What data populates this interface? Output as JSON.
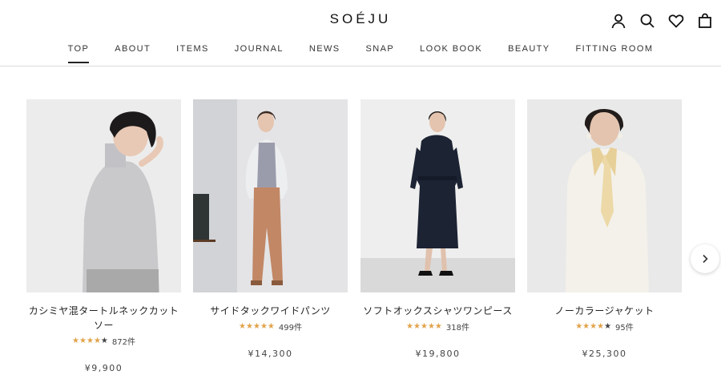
{
  "brand": "SOÉJU",
  "header_icons": [
    "account-icon",
    "search-icon",
    "heart-icon",
    "bag-icon"
  ],
  "nav": [
    {
      "label": "TOP",
      "active": true
    },
    {
      "label": "ABOUT"
    },
    {
      "label": "ITEMS"
    },
    {
      "label": "JOURNAL"
    },
    {
      "label": "NEWS"
    },
    {
      "label": "SNAP"
    },
    {
      "label": "LOOK BOOK"
    },
    {
      "label": "BEAUTY"
    },
    {
      "label": "FITTING ROOM"
    }
  ],
  "products": [
    {
      "name": "カシミヤ混タートルネックカットソー",
      "rating": 4.5,
      "reviews": "872件",
      "price": "¥9,900"
    },
    {
      "name": "サイドタックワイドパンツ",
      "rating": 5,
      "reviews": "499件",
      "price": "¥14,300"
    },
    {
      "name": "ソフトオックスシャツワンピース",
      "rating": 5,
      "reviews": "318件",
      "price": "¥19,800"
    },
    {
      "name": "ノーカラージャケット",
      "rating": 4.5,
      "reviews": "95件",
      "price": "¥25,300"
    }
  ],
  "colors": {
    "star": "#e2a34a",
    "star_empty": "#444444",
    "accent": "#222222"
  }
}
